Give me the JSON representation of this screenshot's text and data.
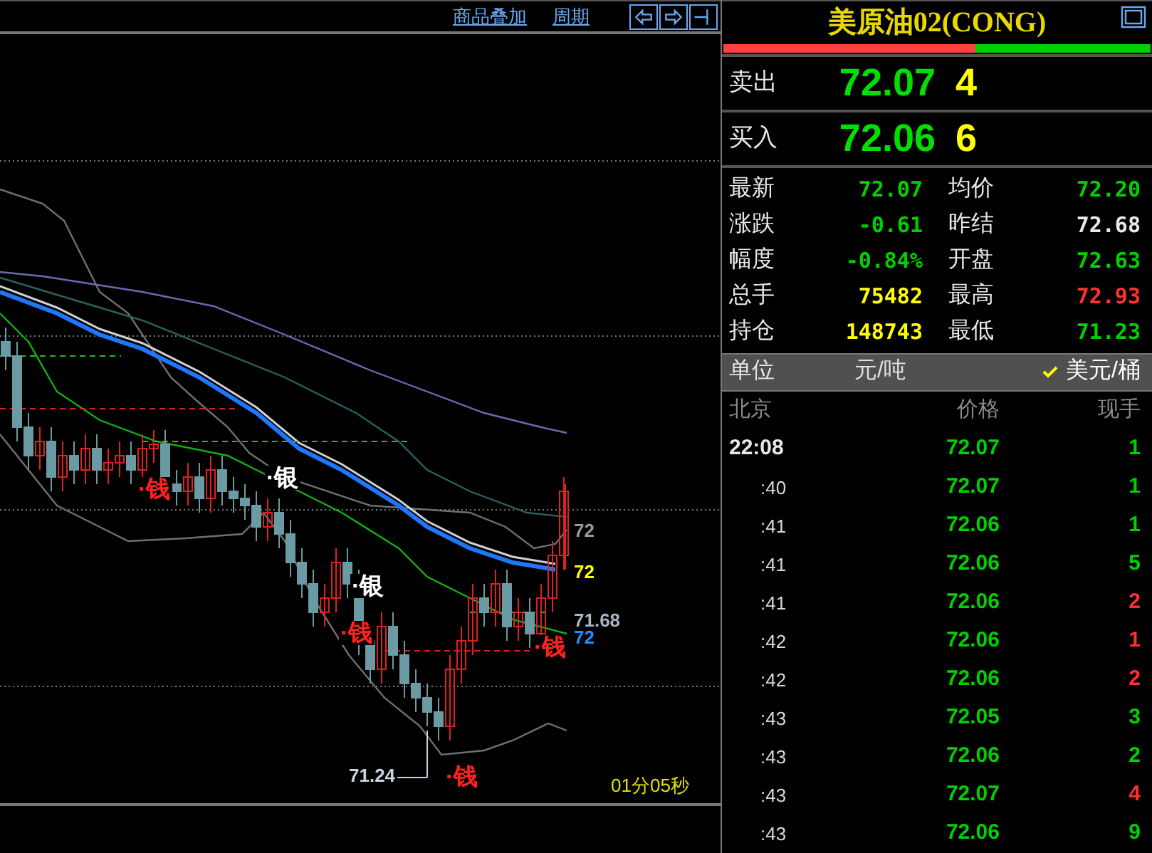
{
  "toolbar": {
    "links": [
      "商品叠加",
      "周期"
    ]
  },
  "chart_labels": [
    {
      "text": "72",
      "kind": "price",
      "color": "#9a9a9a"
    },
    {
      "text": "72",
      "kind": "price",
      "color": "#ffff00"
    },
    {
      "text": "71.68",
      "kind": "price",
      "color": "#a8b4c0"
    },
    {
      "text": "72",
      "kind": "price",
      "color": "#1e90ff"
    },
    {
      "text": "71.24",
      "kind": "low",
      "color": "#c8d4e0"
    },
    {
      "text": "·钱",
      "kind": "marker",
      "color": "#ff2020"
    },
    {
      "text": "·银",
      "kind": "marker",
      "color": "#ffffff"
    },
    {
      "text": "·银",
      "kind": "marker",
      "color": "#ffffff"
    },
    {
      "text": "·钱",
      "kind": "marker",
      "color": "#ff2020"
    },
    {
      "text": "·钱",
      "kind": "marker",
      "color": "#ff2020"
    },
    {
      "text": "·钱",
      "kind": "marker",
      "color": "#ff2020"
    },
    {
      "text": "01分05秒",
      "kind": "timer",
      "color": "#e0e000"
    }
  ],
  "quote": {
    "title": "美原油02(CONG)",
    "ratio": {
      "level": 0.59
    },
    "ask": {
      "label": "卖出",
      "price": "72.07",
      "volume": "4"
    },
    "bid": {
      "label": "买入",
      "price": "72.06",
      "volume": "6"
    },
    "stats": [
      {
        "label": "最新",
        "value": "72.07",
        "color": "#00d000"
      },
      {
        "label": "均价",
        "value": "72.20",
        "color": "#00d000"
      },
      {
        "label": "涨跌",
        "value": "-0.61",
        "color": "#00d000"
      },
      {
        "label": "昨结",
        "value": "72.68",
        "color": "#e8e8e8"
      },
      {
        "label": "幅度",
        "value": "-0.84%",
        "color": "#00d000"
      },
      {
        "label": "开盘",
        "value": "72.63",
        "color": "#00d000"
      },
      {
        "label": "总手",
        "value": "75482",
        "color": "#ffff00"
      },
      {
        "label": "最高",
        "value": "72.93",
        "color": "#ff3030"
      },
      {
        "label": "持仓",
        "value": "148743",
        "color": "#ffff00"
      },
      {
        "label": "最低",
        "value": "71.23",
        "color": "#00d000"
      }
    ],
    "unit": {
      "label": "单位",
      "options": [
        {
          "text": "元/吨",
          "selected": false
        },
        {
          "text": "美元/桶",
          "selected": true
        }
      ]
    },
    "ticks": {
      "columns": [
        "北京",
        "价格",
        "现手"
      ],
      "rows": [
        {
          "time": "22:08",
          "price": "72.07",
          "volume": "1",
          "color": "#00d000"
        },
        {
          "time": ":40",
          "price": "72.07",
          "volume": "1",
          "color": "#00d000"
        },
        {
          "time": ":41",
          "price": "72.06",
          "volume": "1",
          "color": "#00d000"
        },
        {
          "time": ":41",
          "price": "72.06",
          "volume": "5",
          "color": "#00d000"
        },
        {
          "time": ":41",
          "price": "72.06",
          "volume": "2",
          "color": "#ff3030"
        },
        {
          "time": ":42",
          "price": "72.06",
          "volume": "1",
          "color": "#ff3030"
        },
        {
          "time": ":42",
          "price": "72.06",
          "volume": "2",
          "color": "#ff3030"
        },
        {
          "time": ":43",
          "price": "72.05",
          "volume": "3",
          "color": "#00d000"
        },
        {
          "time": ":43",
          "price": "72.06",
          "volume": "2",
          "color": "#00d000"
        },
        {
          "time": ":43",
          "price": "72.07",
          "volume": "4",
          "color": "#ff3030"
        },
        {
          "time": ":43",
          "price": "72.06",
          "volume": "9",
          "color": "#00d000"
        }
      ]
    }
  }
}
